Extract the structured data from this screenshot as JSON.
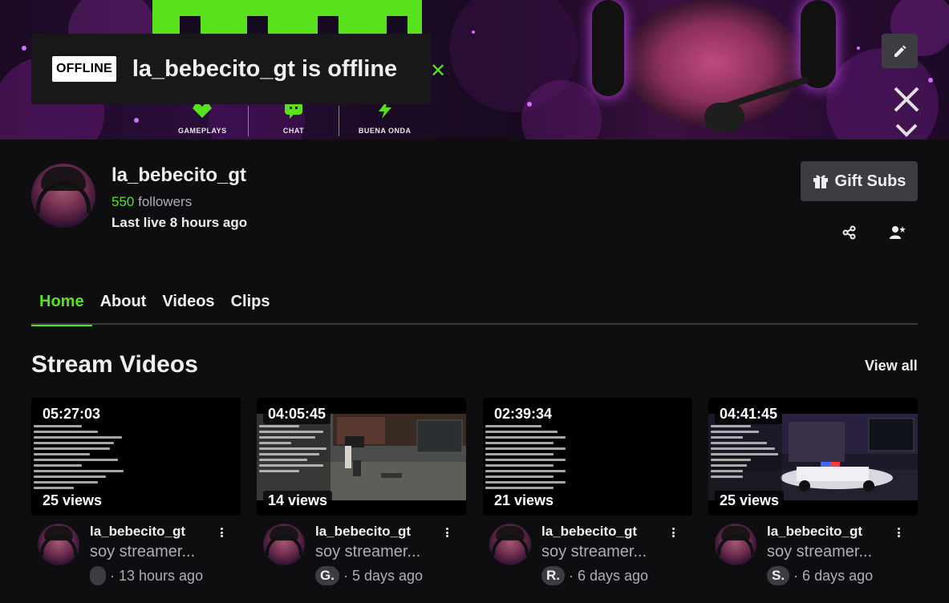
{
  "banner": {
    "nav_items": [
      "GAMEPLAYS",
      "CHAT",
      "BUENA ONDA"
    ],
    "offline_badge": "OFFLINE",
    "offline_text": "la_bebecito_gt is offline",
    "accent_color": "#58e21d"
  },
  "profile": {
    "channel_name": "la_bebecito_gt",
    "followers_count": "550",
    "followers_label": "followers",
    "last_live": "Last live 8 hours ago",
    "gift_subs_label": "Gift Subs"
  },
  "tabs": [
    {
      "label": "Home",
      "active": true
    },
    {
      "label": "About",
      "active": false
    },
    {
      "label": "Videos",
      "active": false
    },
    {
      "label": "Clips",
      "active": false
    }
  ],
  "section": {
    "title": "Stream Videos",
    "view_all": "View all"
  },
  "videos": [
    {
      "duration": "05:27:03",
      "views": "25 views",
      "channel": "la_bebecito_gt",
      "title": "soy streamer...",
      "tag": "",
      "age": "· 13 hours ago"
    },
    {
      "duration": "04:05:45",
      "views": "14 views",
      "channel": "la_bebecito_gt",
      "title": "soy streamer...",
      "tag": "G.",
      "age": "· 5 days ago"
    },
    {
      "duration": "02:39:34",
      "views": "21 views",
      "channel": "la_bebecito_gt",
      "title": "soy streamer...",
      "tag": "R.",
      "age": "· 6 days ago"
    },
    {
      "duration": "04:41:45",
      "views": "25 views",
      "channel": "la_bebecito_gt",
      "title": "soy streamer...",
      "tag": "S.",
      "age": "· 6 days ago"
    }
  ]
}
